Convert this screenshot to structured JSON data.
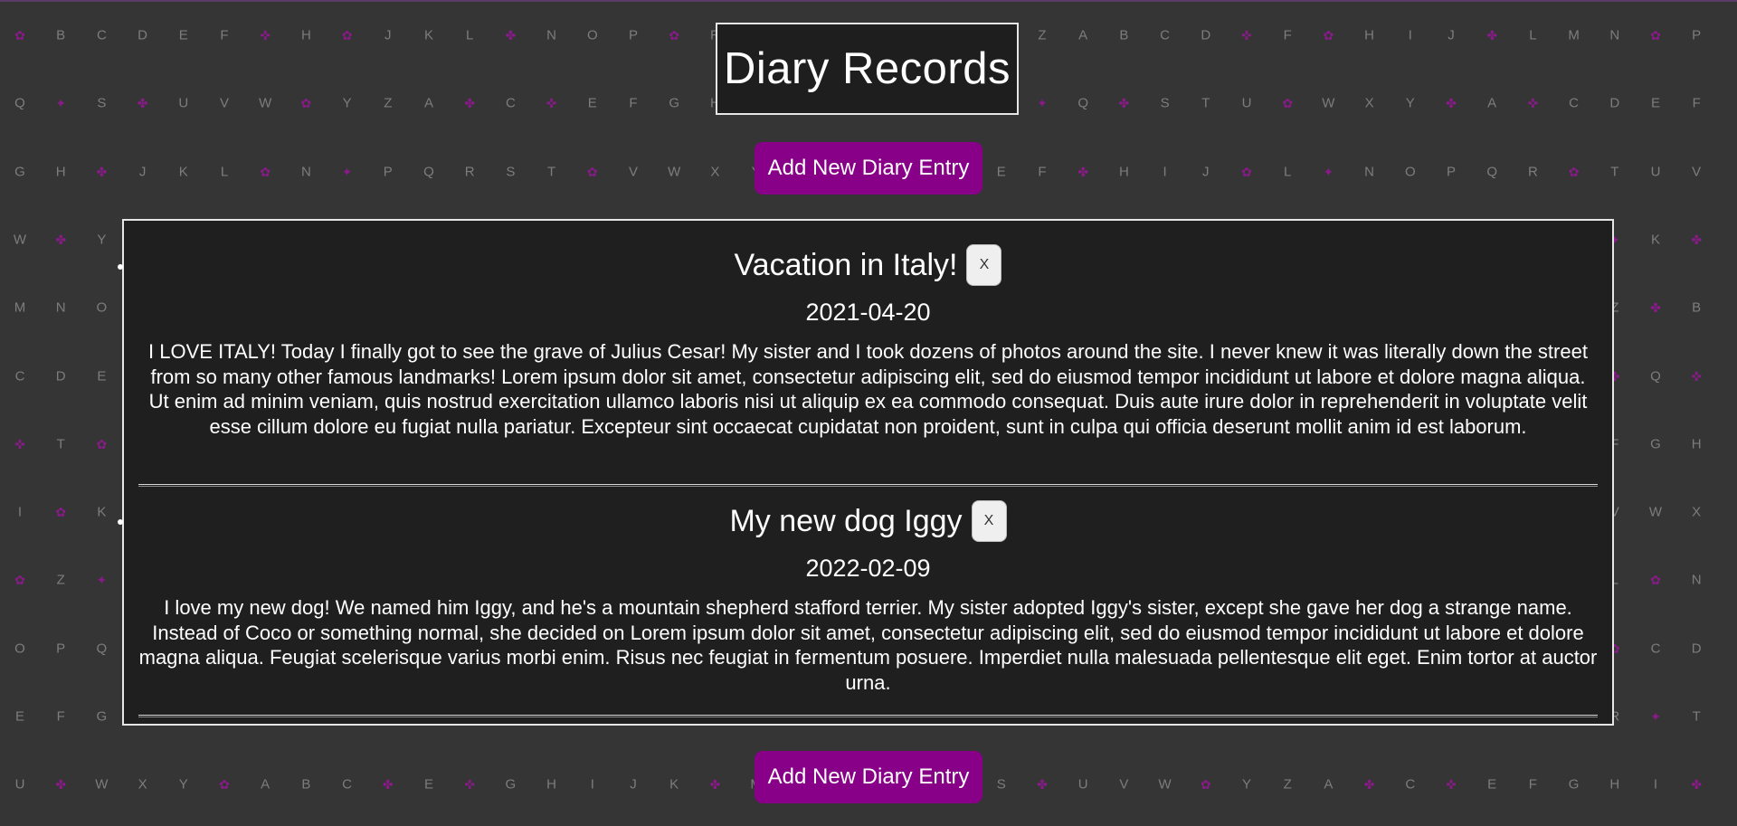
{
  "page_title": "Diary Records",
  "add_button_label": "Add New Diary Entry",
  "entries": [
    {
      "title": "Vacation in Italy!",
      "delete_label": "X",
      "date": "2021-04-20",
      "text": "I LOVE ITALY! Today I finally got to see the grave of Julius Cesar! My sister and I took dozens of photos around the site. I never knew it was literally down the street from so many other famous landmarks! Lorem ipsum dolor sit amet, consectetur adipiscing elit, sed do eiusmod tempor incididunt ut labore et dolore magna aliqua. Ut enim ad minim veniam, quis nostrud exercitation ullamco laboris nisi ut aliquip ex ea commodo consequat. Duis aute irure dolor in reprehenderit in voluptate velit esse cillum dolore eu fugiat nulla pariatur. Excepteur sint occaecat cupidatat non proident, sunt in culpa qui officia deserunt mollit anim id est laborum."
    },
    {
      "title": "My new dog Iggy",
      "delete_label": "X",
      "date": "2022-02-09",
      "text": "I love my new dog! We named him Iggy, and he's a mountain shepherd stafford terrier. My sister adopted Iggy's sister, except she gave her dog a strange name. Instead of Coco or something normal, she decided on Lorem ipsum dolor sit amet, consectetur adipiscing elit, sed do eiusmod tempor incididunt ut labore et dolore magna aliqua. Feugiat scelerisque varius morbi enim. Risus nec feugiat in fermentum posuere. Imperdiet nulla malesuada pellentesque elit eget. Enim tortor at auctor urna."
    }
  ],
  "background": {
    "letter_rows": [
      "ABCDEFGHIJKLMNOPQRSTUVWXYZABCDEFGHIJKLMNOP",
      "QRSTUVWXYZABCDEFGHIJKLMNOPQRSTUVWXYZABCDEF",
      "GHIJKLMNOPQRSTUVWXYZABCDEFGHIJKLMNOPQRSTUV",
      "WXYZABCDEFGHIJKLMNOPQRSTUVWXYZABCDEFGHIJKL",
      "MNOPQRSTUVWXYZABCDEFGHIJKLMNOPQRSTUVWXYZAB",
      "CDEFGHIJKLMNOPQRSTUVWXYZABCDEFGHIJKLMNOPQR",
      "STUVWXYZABCDEFGHIJKLMNOPQRSTUVWXYZABCDEFGH",
      "IJKLMNOPQRSTUVWXYZABCDEFGHIJKLMNOPQRSTUVWX",
      "YZABCDEFGHIJKLMNOPQRSTUVWXYZABCDEFGHIJKLMN",
      "OPQRSTUVWXYZABCDEFGHIJKLMNOPQRSTUVWXYZABCD",
      "EFGHIJKLMNOPQRSTUVWXYZABCDEFGHIJKLMNOPQRST",
      "UVWXYZABCDEFGHIJKLMNOPQRSTUVWXYZABCDEFGHIJ"
    ],
    "glyph_color": "#8a1a8a",
    "letter_color": "#7d7d7d"
  },
  "colors": {
    "accent": "#870087",
    "page_bg": "#353535",
    "panel_bg": "#1f1f1f",
    "border": "#e6e6e6"
  }
}
